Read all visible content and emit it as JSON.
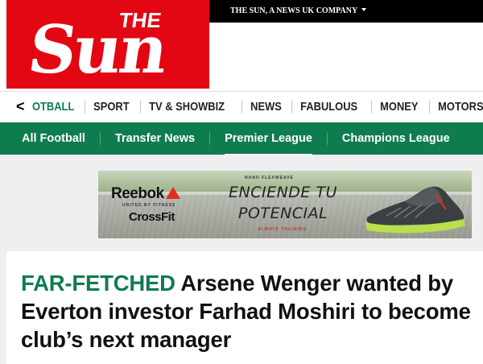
{
  "masthead": {
    "logo_the": "THE",
    "logo_sun": "Sun",
    "company_link": "THE SUN, A NEWS UK COMPANY"
  },
  "nav": {
    "back_glyph": "<",
    "items": [
      "OTBALL",
      "SPORT",
      "TV & SHOWBIZ",
      "NEWS",
      "FABULOUS",
      "MONEY",
      "MOTORS"
    ]
  },
  "subnav": {
    "items": [
      "All Football",
      "Transfer News",
      "Premier League",
      "Champions League"
    ],
    "active_index": 2
  },
  "ad": {
    "brand": "Reebok",
    "brand_sub": "UNITED BY FITNESS",
    "crossfit": "CrossFit",
    "product_label": "NANO FLEXWEAVE",
    "headline_1": "ENCIENDE TU",
    "headline_2": "POTENCIAL",
    "tagline": "ALWAYS TRAINING"
  },
  "article": {
    "kicker": "FAR-FETCHED",
    "title": "Arsene Wenger wanted by Everton investor Farhad Moshiri to become club’s next manager"
  },
  "colors": {
    "brand_red": "#e30613",
    "football_green": "#0f7c4f",
    "topbar_black": "#000000"
  }
}
